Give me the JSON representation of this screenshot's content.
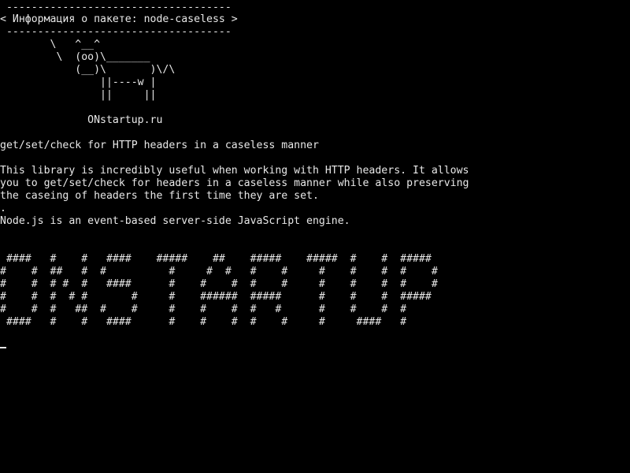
{
  "terminal": {
    "bg_color": "#000000",
    "fg_color": "#e8e8e8",
    "speech_bubble": {
      "top_border": " ------------------------------------",
      "text": "< Информация о пакете: node-caseless >",
      "bottom_border": " ------------------------------------"
    },
    "cow": [
      "        \\   ^__^",
      "         \\  (oo)\\_______",
      "            (__)\\       )\\/\\",
      "                ||----w |",
      "                ||     ||"
    ],
    "site": "              ONstartup.ru",
    "summary": "get/set/check for HTTP headers in a caseless manner",
    "description": [
      "This library is incredibly useful when working with HTTP headers. It allows",
      "you to get/set/check for headers in a caseless manner while also preserving",
      "the caseing of headers the first time they are set."
    ],
    "dot": ".",
    "nodejs_line": "Node.js is an event-based server-side JavaScript engine.",
    "banner": [
      " ####   #    #   ####    #####    ##    #####    #####  #    #  #####",
      "#    #  ##   #  #          #     #  #   #    #     #    #    #  #    #",
      "#    #  # #  #   ####      #    #    #  #    #     #    #    #  #    #",
      "#    #  #  # #       #     #    ######  #####      #    #    #  #####",
      "#    #  #   ##  #    #     #    #    #  #   #      #    #    #  #",
      " ####   #    #   ####      #    #    #  #    #     #     ####   #"
    ]
  }
}
